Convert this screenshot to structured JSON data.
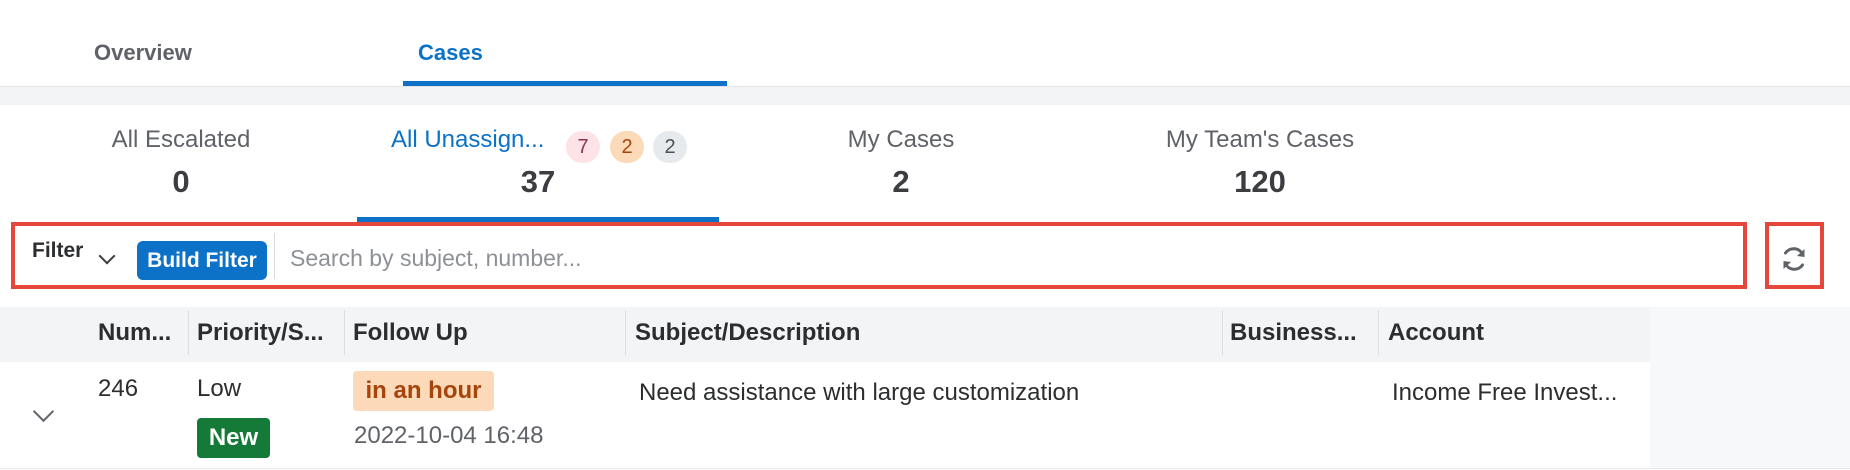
{
  "top_tabs": [
    {
      "label": "Overview"
    },
    {
      "label": "Cases"
    }
  ],
  "saved_views": [
    {
      "label": "All Escalated",
      "count": "0"
    },
    {
      "label": "All Unassign...",
      "count": "37",
      "badges": [
        {
          "value": "7",
          "color": "#fde3e8",
          "text_color": "#8a3357"
        },
        {
          "value": "2",
          "color": "#fcd9b8",
          "text_color": "#a5450c"
        },
        {
          "value": "2",
          "color": "#e7eaed",
          "text_color": "#4c5157"
        }
      ]
    },
    {
      "label": "My Cases",
      "count": "2"
    },
    {
      "label": "My Team's Cases",
      "count": "120"
    }
  ],
  "filter": {
    "dropdown_label": "Filter",
    "build_label": "Build Filter",
    "search_placeholder": "Search by subject, number..."
  },
  "icons": {
    "refresh": "refresh-icon",
    "expand": "chevron-down-icon",
    "filter_dropdown": "chevron-down-icon"
  },
  "table": {
    "columns": [
      "Num...",
      "Priority/S...",
      "Follow Up",
      "Subject/Description",
      "Business...",
      "Account"
    ],
    "rows": [
      {
        "number": "246",
        "priority": "Low",
        "status": "New",
        "follow_up_badge": "in an hour",
        "follow_up_date": "2022-10-04 16:48",
        "subject": "Need assistance with large customization",
        "business": "",
        "account": "Income Free Invest..."
      }
    ]
  },
  "colors": {
    "accent": "#0b72c8",
    "highlight_frame": "#e5483b",
    "status_new": "#157a38",
    "follow_up_bg": "#fcd9b8"
  }
}
